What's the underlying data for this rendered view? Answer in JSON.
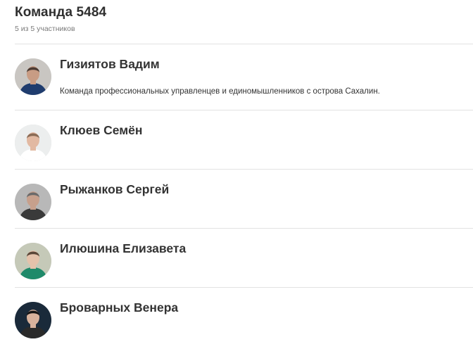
{
  "team": {
    "title": "Команда 5484",
    "subtitle": "5 из 5 участников"
  },
  "members": [
    {
      "name": "Гизиятов Вадим",
      "description": "Команда профессиональных управленцев и единомышленников с острова Сахалин.",
      "avatar_icon": "user-photo-icon",
      "avatar_colors": {
        "bg": "#c9c6c2",
        "skin": "#c89c84",
        "hair": "#4a3a32",
        "clothes": "#1f3c6e"
      }
    },
    {
      "name": "Клюев Семён",
      "description": "",
      "avatar_icon": "user-photo-icon",
      "avatar_colors": {
        "bg": "#eceeee",
        "skin": "#e2b9a2",
        "hair": "#8a6b55",
        "clothes": "#ffffff"
      }
    },
    {
      "name": "Рыжанков Сергей",
      "description": "",
      "avatar_icon": "user-photo-icon",
      "avatar_colors": {
        "bg": "#b8b8b8",
        "skin": "#c7a08c",
        "hair": "#6a6a6a",
        "clothes": "#3a3a3a"
      }
    },
    {
      "name": "Илюшина Елизавета",
      "description": "",
      "avatar_icon": "user-photo-icon",
      "avatar_colors": {
        "bg": "#c5c9b8",
        "skin": "#e4c2ab",
        "hair": "#5a4638",
        "clothes": "#1f8a6a"
      }
    },
    {
      "name": "Броварных Венера",
      "description": "",
      "avatar_icon": "user-photo-icon",
      "avatar_colors": {
        "bg": "#1a2a3a",
        "skin": "#d8b29c",
        "hair": "#141414",
        "clothes": "#2a2a2a"
      }
    }
  ]
}
